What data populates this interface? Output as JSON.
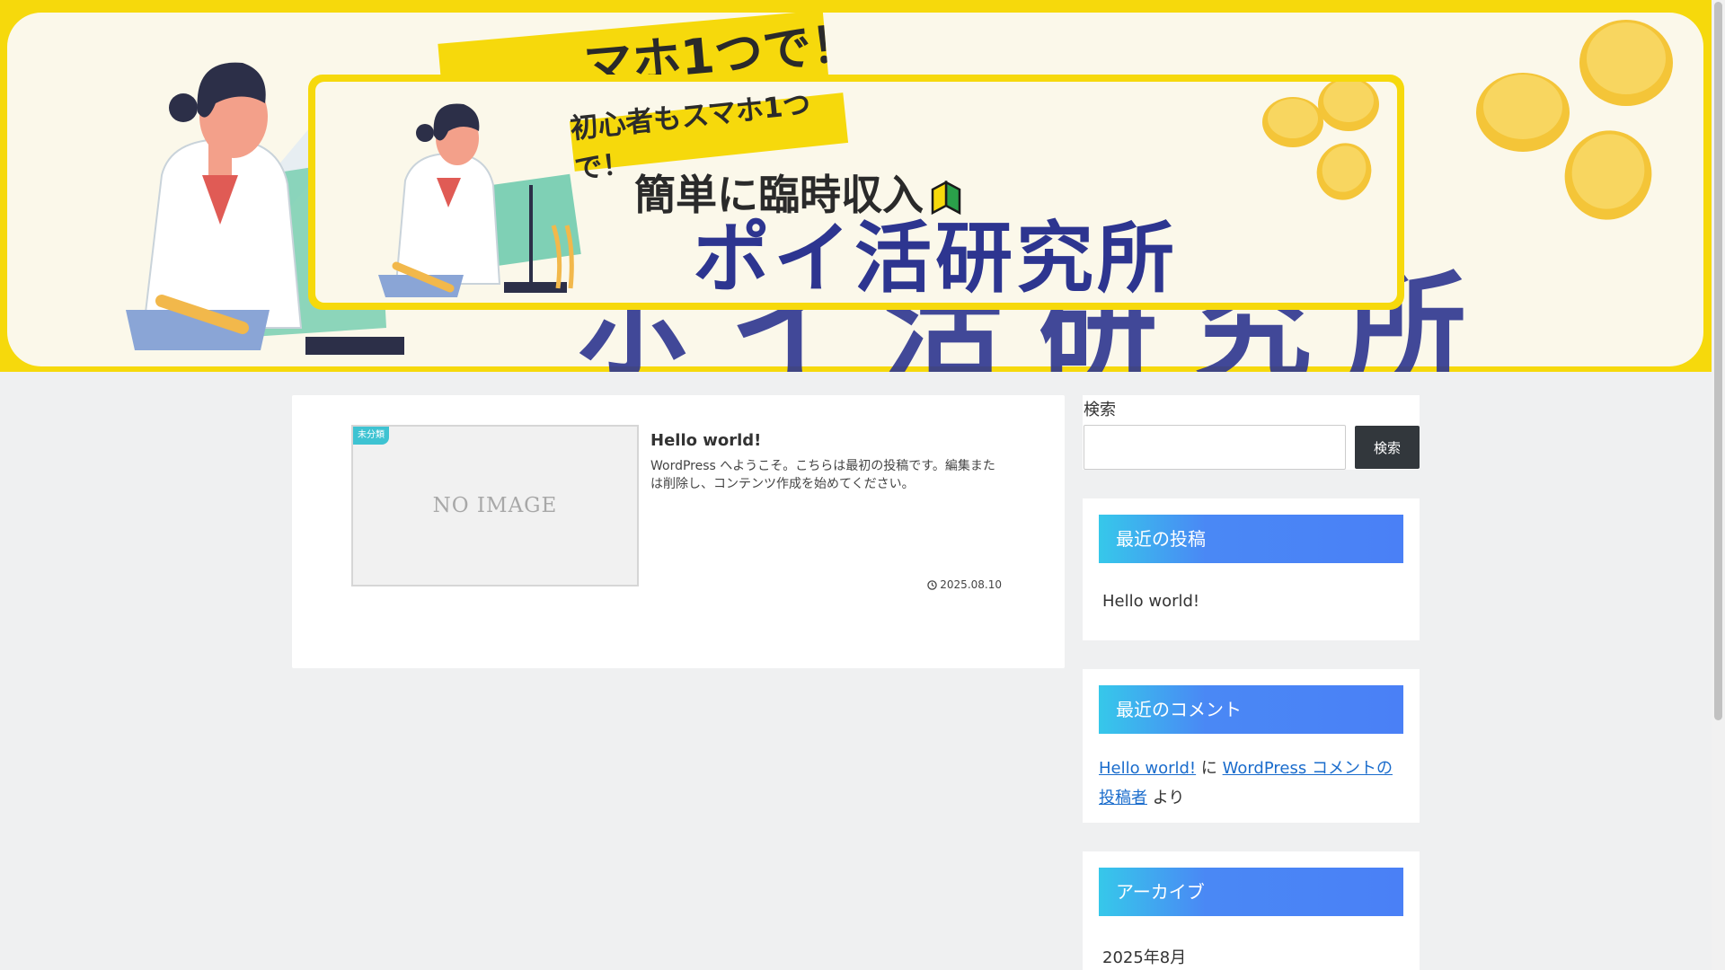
{
  "header": {
    "bg_tagline_fragment": "マホ1つで！",
    "bg_title_fragment": "ポイ活研究所",
    "catch_tag": "初心者もスマホ1つで！",
    "catch_sub": "簡単に臨時収入",
    "site_title": "ポイ活研究所",
    "colors": {
      "frame": "#f6d90c",
      "cream": "#fbf8ea",
      "navy": "#2d3590"
    }
  },
  "main": {
    "entry": {
      "category": "未分類",
      "thumbnail_text": "NO IMAGE",
      "title": "Hello world!",
      "snippet": "WordPress へようこそ。こちらは最初の投稿です。編集または削除し、コンテンツ作成を始めてください。",
      "date": "2025.08.10",
      "date_icon": "clock-icon"
    }
  },
  "sidebar": {
    "search": {
      "label": "検索",
      "placeholder": "",
      "button_label": "検索"
    },
    "recent_posts": {
      "title": "最近の投稿",
      "items": [
        "Hello world!"
      ]
    },
    "recent_comments": {
      "title": "最近のコメント",
      "post_link": "Hello world!",
      "connector": "に",
      "author_link": "WordPress コメントの投稿者",
      "suffix": "より"
    },
    "archives": {
      "title": "アーカイブ",
      "items": [
        "2025年8月"
      ]
    },
    "colors": {
      "widget_title_start": "#36c8ea",
      "widget_title_end": "#4a80f6",
      "search_button": "#32373c"
    }
  }
}
